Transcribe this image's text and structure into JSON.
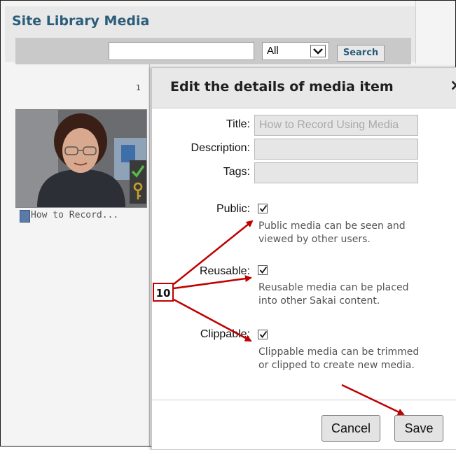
{
  "library": {
    "title": "Site Library Media",
    "search_placeholder": "",
    "filter_selected": "All",
    "search_button": "Search",
    "page_number": "1",
    "media_items": [
      {
        "label": "How to Record..."
      }
    ]
  },
  "dialog": {
    "title": "Edit the details of media item",
    "close_glyph": "×",
    "fields": {
      "title_label": "Title:",
      "title_value": "How to Record Using Media",
      "description_label": "Description:",
      "description_value": "",
      "tags_label": "Tags:",
      "tags_value": ""
    },
    "options": [
      {
        "label": "Public:",
        "checked": true,
        "desc_line1": "Public media can be seen and",
        "desc_line2": "viewed by other users."
      },
      {
        "label": "Reusable:",
        "checked": true,
        "desc_line1": "Reusable media can be placed",
        "desc_line2": "into other Sakai content."
      },
      {
        "label": "Clippable:",
        "checked": true,
        "desc_line1": "Clippable media can be trimmed",
        "desc_line2": "or clipped to create new media."
      }
    ],
    "cancel_button": "Cancel",
    "save_button": "Save"
  },
  "annotation": {
    "callout_number": "10",
    "color": "#c00000"
  },
  "colors": {
    "accent_text": "#2a5d7a",
    "badge_green": "#58b947",
    "badge_yellow": "#c9a227"
  }
}
